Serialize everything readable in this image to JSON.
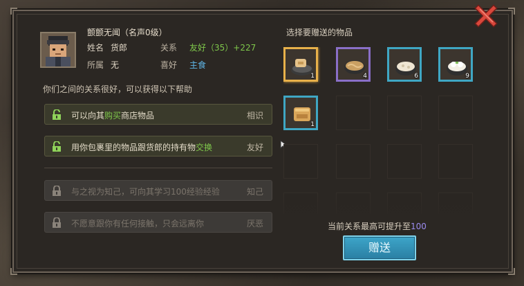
{
  "npc": {
    "name": "颤颤无闻（名声0级）",
    "surname_label": "姓名",
    "surname_value": "货郎",
    "relation_label": "关系",
    "relation_value": "友好（35）+227",
    "faction_label": "所属",
    "faction_value": "无",
    "hobby_label": "喜好",
    "hobby_value": "主食"
  },
  "relation_desc": "你们之间的关系很好，可以获得以下帮助",
  "benefits": [
    {
      "pre": "可以向其",
      "hl": "购买",
      "post": "商店物品",
      "level": "相识",
      "unlocked": true
    },
    {
      "pre": "用你包裹里的物品跟货郎的持有物",
      "hl": "交换",
      "post": "",
      "level": "友好",
      "unlocked": true
    },
    {
      "pre": "与之视为知己，可向其学习100经验经验",
      "hl": "",
      "post": "",
      "level": "知己",
      "unlocked": false
    },
    {
      "pre": "不愿意跟你有任何接触，只会远离你",
      "hl": "",
      "post": "",
      "level": "厌恶",
      "unlocked": false
    }
  ],
  "gift": {
    "title": "选择要赠送的物品",
    "items": [
      {
        "icon": "dumpling-plate-icon",
        "count": "1",
        "frame": "selected"
      },
      {
        "icon": "noodle-bowl-icon",
        "count": "4",
        "frame": "purple"
      },
      {
        "icon": "rice-porridge-icon",
        "count": "6",
        "frame": "teal"
      },
      {
        "icon": "steamed-bun-bowl-icon",
        "count": "9",
        "frame": "teal"
      },
      {
        "icon": "spring-roll-icon",
        "count": "1",
        "frame": "teal"
      }
    ],
    "max_note_pre": "当前关系最高可提升至",
    "max_note_value": "100",
    "button_label": "赠送"
  },
  "colors": {
    "highlight_green": "#7fc84b",
    "relation_blue": "#5fb6e8",
    "max_value_purple": "#9c8cf0",
    "button_blue": "#3da5c9",
    "selected_gold": "#e8b14a"
  }
}
